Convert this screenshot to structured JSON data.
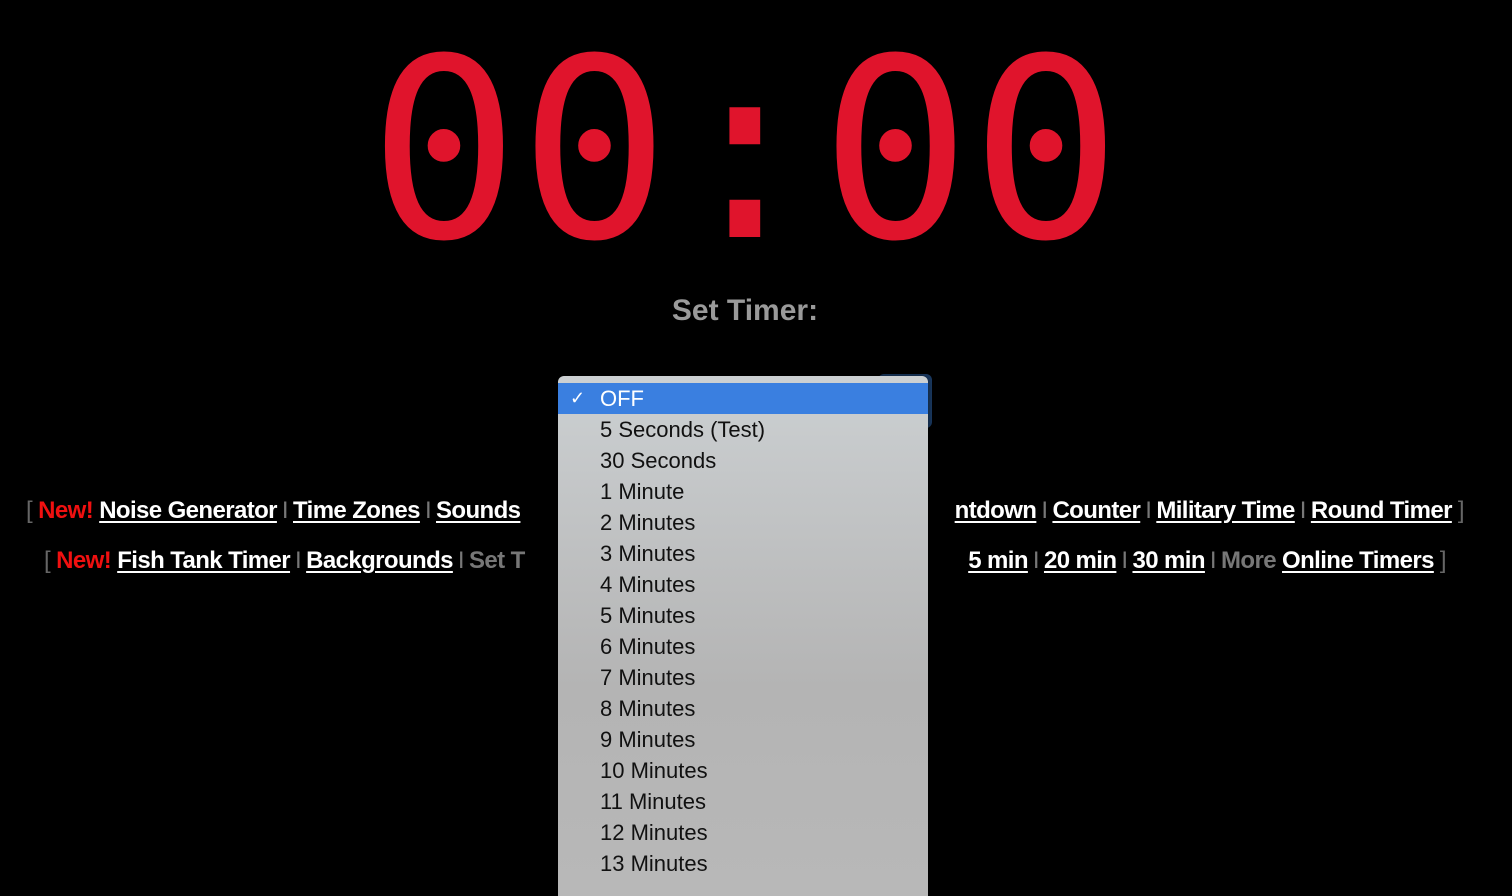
{
  "clock": {
    "display": "00:00",
    "digits": [
      "0",
      "0",
      "0",
      "0"
    ],
    "color": "#e0142c"
  },
  "set_timer_label": "Set Timer:",
  "row1": {
    "open": "[",
    "new": "New!",
    "close": "]",
    "left_links": [
      "Noise Generator",
      "Time Zones",
      "Sounds"
    ],
    "right_partial": "ntdown",
    "right_links": [
      "Counter",
      "Military Time",
      "Round Timer"
    ],
    "sep": "I"
  },
  "row2": {
    "open": "[",
    "new": "New!",
    "close": "]",
    "left_links": [
      "Fish Tank Timer",
      "Backgrounds"
    ],
    "left_partial_text": "Set T",
    "right_partial": "5 min",
    "right_links": [
      "20 min",
      "30 min"
    ],
    "more_text": "More",
    "more_link": "Online Timers",
    "sep": "I"
  },
  "dropdown": {
    "selected": "OFF",
    "check_icon": "✓",
    "options": [
      "OFF",
      "5 Seconds (Test)",
      "30 Seconds",
      "1 Minute",
      "2 Minutes",
      "3 Minutes",
      "4 Minutes",
      "5 Minutes",
      "6 Minutes",
      "7 Minutes",
      "8 Minutes",
      "9 Minutes",
      "10 Minutes",
      "11 Minutes",
      "12 Minutes",
      "13 Minutes"
    ],
    "highlight_color": "#3a7fe0"
  }
}
